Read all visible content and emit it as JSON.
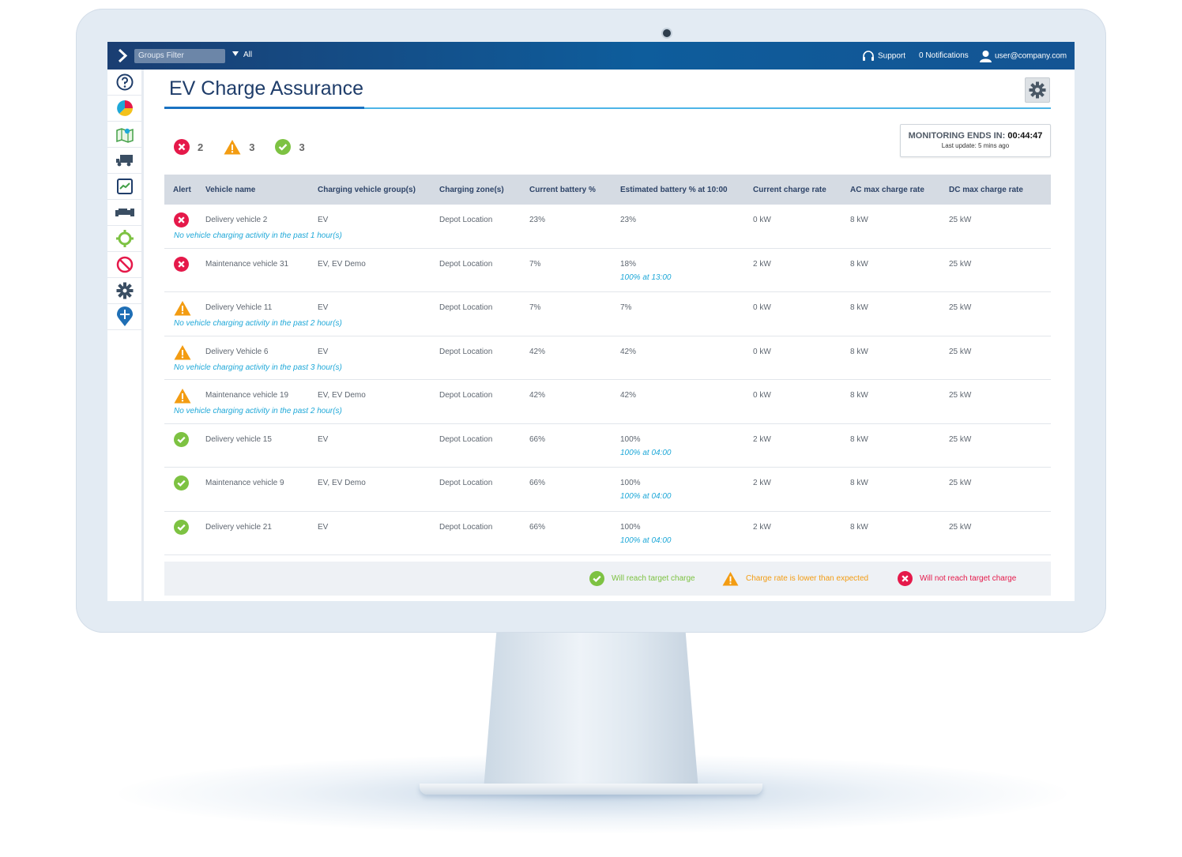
{
  "topbar": {
    "groups_filter": "Groups Filter",
    "all_label": "All",
    "support": "Support",
    "notifications": "0 Notifications",
    "user": "user@company.com"
  },
  "page": {
    "title": "EV Charge Assurance"
  },
  "summary": {
    "errors": "2",
    "warnings": "3",
    "ok": "3"
  },
  "monitoring": {
    "label": "MONITORING ENDS IN:",
    "time": "00:44:47",
    "last_update": "Last update: 5 mins ago"
  },
  "table": {
    "headers": {
      "alert": "Alert",
      "vehicle": "Vehicle name",
      "group": "Charging vehicle group(s)",
      "zone": "Charging zone(s)",
      "current": "Current battery %",
      "estimated": "Estimated battery % at 10:00",
      "rate": "Current charge rate",
      "ac": "AC max charge rate",
      "dc": "DC max charge rate"
    },
    "rows": [
      {
        "status": "error",
        "vehicle": "Delivery vehicle 2",
        "group": "EV",
        "zone": "Depot Location",
        "current": "23%",
        "estimated": "23%",
        "sub": "",
        "rate": "0 kW",
        "ac": "8 kW",
        "dc": "25 kW",
        "note": "No vehicle charging activity in the past 1 hour(s)"
      },
      {
        "status": "error",
        "vehicle": "Maintenance vehicle 31",
        "group": "EV, EV Demo",
        "zone": "Depot Location",
        "current": "7%",
        "estimated": "18%",
        "sub": "100% at 13:00",
        "rate": "2 kW",
        "ac": "8 kW",
        "dc": "25 kW",
        "note": ""
      },
      {
        "status": "warning",
        "vehicle": "Delivery Vehicle 11",
        "group": "EV",
        "zone": "Depot Location",
        "current": "7%",
        "estimated": "7%",
        "sub": "",
        "rate": "0 kW",
        "ac": "8 kW",
        "dc": "25 kW",
        "note": "No vehicle charging activity in the past 2 hour(s)"
      },
      {
        "status": "warning",
        "vehicle": "Delivery Vehicle 6",
        "group": "EV",
        "zone": "Depot Location",
        "current": "42%",
        "estimated": "42%",
        "sub": "",
        "rate": "0 kW",
        "ac": "8 kW",
        "dc": "25 kW",
        "note": "No vehicle charging activity in the past 3 hour(s)"
      },
      {
        "status": "warning",
        "vehicle": "Maintenance vehicle 19",
        "group": "EV, EV Demo",
        "zone": "Depot Location",
        "current": "42%",
        "estimated": "42%",
        "sub": "",
        "rate": "0 kW",
        "ac": "8 kW",
        "dc": "25 kW",
        "note": "No vehicle charging activity in the past 2 hour(s)"
      },
      {
        "status": "ok",
        "vehicle": "Delivery vehicle 15",
        "group": "EV",
        "zone": "Depot Location",
        "current": "66%",
        "estimated": "100%",
        "sub": "100% at 04:00",
        "rate": "2 kW",
        "ac": "8 kW",
        "dc": "25 kW",
        "note": ""
      },
      {
        "status": "ok",
        "vehicle": "Maintenance vehicle 9",
        "group": "EV, EV Demo",
        "zone": "Depot Location",
        "current": "66%",
        "estimated": "100%",
        "sub": "100% at 04:00",
        "rate": "2 kW",
        "ac": "8 kW",
        "dc": "25 kW",
        "note": ""
      },
      {
        "status": "ok",
        "vehicle": "Delivery vehicle 21",
        "group": "EV",
        "zone": "Depot Location",
        "current": "66%",
        "estimated": "100%",
        "sub": "100% at 04:00",
        "rate": "2 kW",
        "ac": "8 kW",
        "dc": "25 kW",
        "note": ""
      }
    ]
  },
  "legend": {
    "ok": "Will reach target charge",
    "warning": "Charge rate is lower than expected",
    "error": "Will not reach target charge"
  },
  "colors": {
    "error": "#e5194a",
    "warning": "#f39c12",
    "ok": "#7dc242",
    "accent": "#1fa8d8",
    "topbar": "#10548f"
  },
  "sidebar_icons": [
    "help-icon",
    "pie-chart-icon",
    "map-icon",
    "truck-icon",
    "trend-chart-icon",
    "engine-icon",
    "gear-puzzle-icon",
    "no-entry-icon",
    "settings-gear-icon",
    "location-pin-icon"
  ]
}
